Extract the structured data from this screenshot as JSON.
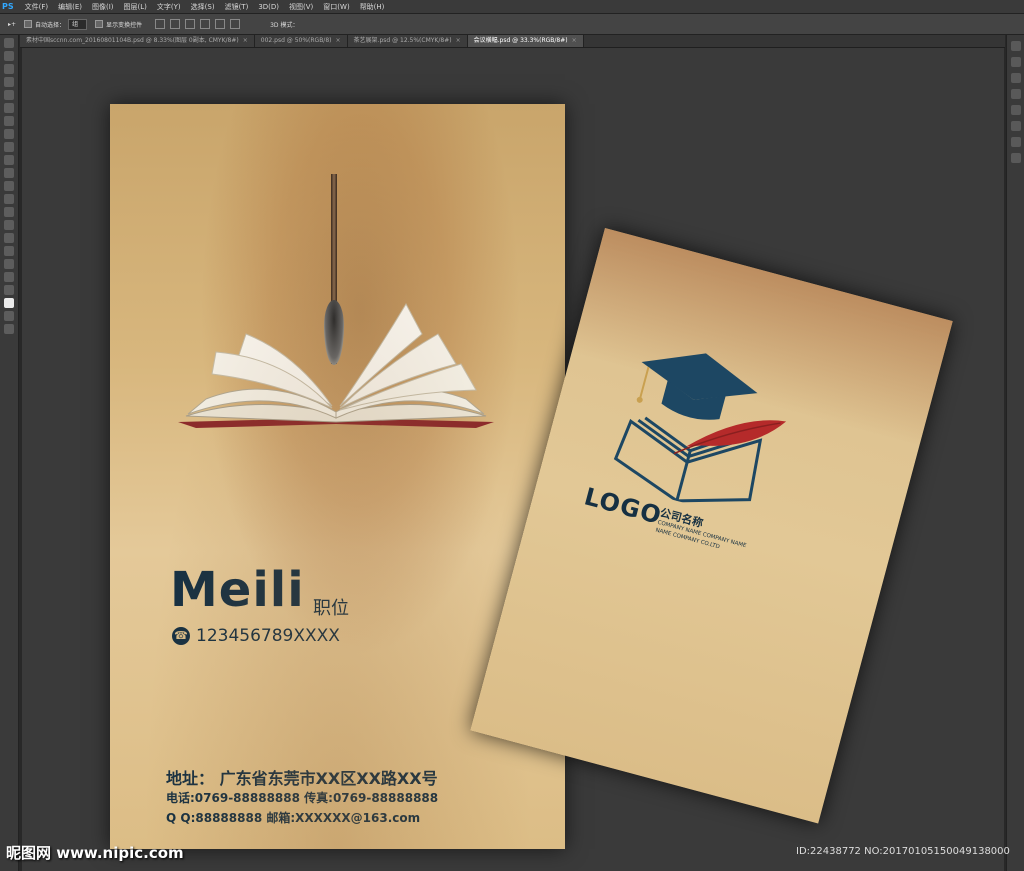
{
  "app": {
    "logo": "PS",
    "menu": [
      "文件(F)",
      "编辑(E)",
      "图像(I)",
      "图层(L)",
      "文字(Y)",
      "选择(S)",
      "滤镜(T)",
      "3D(D)",
      "视图(V)",
      "窗口(W)",
      "帮助(H)"
    ]
  },
  "options": {
    "auto_select_label": "自动选择：",
    "auto_select_value": "组",
    "show_transform_label": "显示变换控件",
    "mode_3d_label": "3D 模式："
  },
  "tabs": [
    {
      "label": "素材中国sccnn.com_20160801104B.psd @ 8.33%(图层 0副本, CMYK/8#)",
      "active": false
    },
    {
      "label": "002.psd @ 50%(RGB/8)",
      "active": false
    },
    {
      "label": "茶艺展架.psd @ 12.5%(CMYK/8#)",
      "active": false
    },
    {
      "label": "会议横幅.psd @ 33.3%(RGB/8#)",
      "active": true
    }
  ],
  "card_front": {
    "name": "Meili",
    "position": "职位",
    "phone": "123456789XXXX",
    "address": "地址：  广东省东莞市XX区XX路XX号",
    "tel_fax": "电话:0769-88888888  传真:0769-88888888",
    "qq_email": "Q  Q:88888888   邮箱:XXXXXX@163.com"
  },
  "card_back": {
    "logo": "LOGO",
    "company_cn": "公司名称",
    "company_en1": "COMPANY NAME COMPANY NAME",
    "company_en2": "NAME COMPANY CO.LTD"
  },
  "watermark": {
    "left": "昵图网 www.nipic.com",
    "right": "ID:22438772 NO:20170105150049138000"
  },
  "colors": {
    "ink": "#163042",
    "paper": "#d8b77e",
    "cap": "#1d4763",
    "feather": "#b52a2a"
  }
}
